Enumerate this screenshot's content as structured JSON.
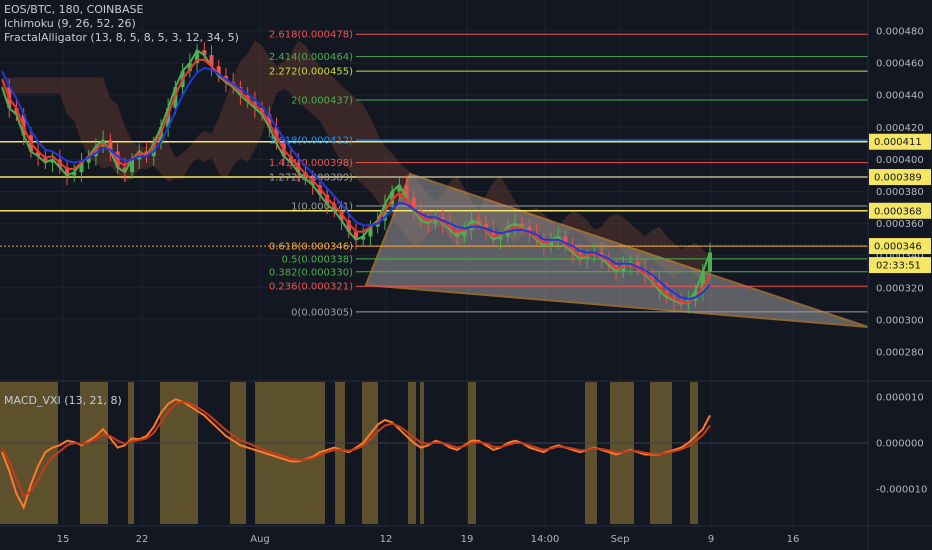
{
  "header": {
    "symbol_line": "EOS/BTC, 180, COINBASE",
    "ichimoku": "Ichimoku (9, 26, 52, 26)",
    "alligator": "FractalAlligator (13, 8, 5, 8, 5, 3, 12, 34, 5)"
  },
  "macd_label": "MACD_VXI (13, 21, 8)",
  "colors": {
    "background": "#131722",
    "grid": "#1e2230",
    "yellow": "#f5e663",
    "triangle_fill": "#9a9a9a",
    "triangle_stroke": "#f4a83a",
    "candle_up": "#4caf50",
    "candle_down": "#ef5350",
    "lip": "#4caf50",
    "teeth": "#e53935",
    "jaw": "#1e3adb",
    "macd": "#ff7a2a",
    "signal": "#c43b1a",
    "macd_bg": "#6b5a2e"
  },
  "chart_data": {
    "type": "line",
    "title": "EOS/BTC, 180, COINBASE",
    "ylim": [
      0.00027,
      0.00049
    ],
    "y_ticks": [
      "0.000480",
      "0.000460",
      "0.000440",
      "0.000420",
      "0.000400",
      "0.000380",
      "0.000360",
      "0.000340",
      "0.000320",
      "0.000300",
      "0.000280"
    ],
    "x_ticks": [
      "15",
      "22",
      "Aug",
      "12",
      "19",
      "14:00",
      "Sep",
      "9",
      "16"
    ],
    "price_tags": [
      {
        "label": "0.000411",
        "value": 0.000411,
        "color": "#f5e663"
      },
      {
        "label": "0.000389",
        "value": 0.000389,
        "color": "#f5e663"
      },
      {
        "label": "0.000368",
        "value": 0.000368,
        "color": "#f5e663"
      },
      {
        "label": "0.000346",
        "value": 0.000346,
        "color": "#f5e663"
      }
    ],
    "countdown": "02:33:51",
    "horizontal_levels": [
      0.000411,
      0.000389,
      0.000368
    ],
    "fib_levels": [
      {
        "label": "2.618(0.000478)",
        "value": 0.000478,
        "color": "#ef5350"
      },
      {
        "label": "2.414(0.000464)",
        "value": 0.000464,
        "color": "#4caf50"
      },
      {
        "label": "2.272(0.000455)",
        "value": 0.000455,
        "color": "#cddc39"
      },
      {
        "label": "2(0.000437)",
        "value": 0.000437,
        "color": "#4caf50"
      },
      {
        "label": "1.618(0.000412)",
        "value": 0.000412,
        "color": "#2196f3"
      },
      {
        "label": "1.414(0.000398)",
        "value": 0.000398,
        "color": "#ef5350"
      },
      {
        "label": "1.272(0.000389)",
        "value": 0.000389,
        "color": "#9e9e9e"
      },
      {
        "label": "1(0.000371)",
        "value": 0.000371,
        "color": "#9e9e9e"
      },
      {
        "label": "0.618(0.000346)",
        "value": 0.000346,
        "color": "#f4a83a"
      },
      {
        "label": "0.5(0.000338)",
        "value": 0.000338,
        "color": "#4caf50"
      },
      {
        "label": "0.382(0.000330)",
        "value": 0.00033,
        "color": "#4caf50"
      },
      {
        "label": "0.236(0.000321)",
        "value": 0.000321,
        "color": "#ef5350"
      },
      {
        "label": "0(0.000305)",
        "value": 0.000305,
        "color": "#9e9e9e"
      }
    ],
    "series": [
      {
        "values": [
          0.000445,
          0.000432,
          0.000428,
          0.000415,
          0.000405,
          0.000402,
          0.000398,
          0.0004,
          0.000395,
          0.00039,
          0.000392,
          0.000398,
          0.000402,
          0.000408,
          0.000412,
          0.000405,
          0.000395,
          0.000392,
          0.0004,
          0.000405,
          0.000402,
          0.00041,
          0.00042,
          0.000432,
          0.000445,
          0.000455,
          0.00046,
          0.000468,
          0.000465,
          0.000458,
          0.000452,
          0.000448,
          0.000445,
          0.00044,
          0.000436,
          0.000432,
          0.000428,
          0.00042,
          0.00041,
          0.000402,
          0.000398,
          0.000392,
          0.000388,
          0.000384,
          0.000378,
          0.000372,
          0.000368,
          0.000362,
          0.000355,
          0.00035,
          0.000352,
          0.000358,
          0.000362,
          0.000372,
          0.00038,
          0.000384,
          0.000376,
          0.000368,
          0.000362,
          0.00036,
          0.000364,
          0.00036,
          0.000356,
          0.000352,
          0.000356,
          0.000362,
          0.00036,
          0.000356,
          0.00035,
          0.000352,
          0.000358,
          0.00036,
          0.000358,
          0.000354,
          0.00035,
          0.000346,
          0.00035,
          0.000352,
          0.000346,
          0.000342,
          0.000338,
          0.00034,
          0.000342,
          0.000338,
          0.000334,
          0.00033,
          0.000334,
          0.000336,
          0.000332,
          0.000328,
          0.000324,
          0.000318,
          0.000314,
          0.000312,
          0.00031,
          0.000312,
          0.000318,
          0.00033,
          0.000342
        ]
      },
      {
        "values": [
          0.00045,
          0.000438,
          0.000432,
          0.00042,
          0.00041,
          0.000405,
          0.000401,
          0.000402,
          0.000398,
          0.000394,
          0.000394,
          0.000398,
          0.000402,
          0.000406,
          0.00041,
          0.000406,
          0.000399,
          0.000396,
          0.0004,
          0.000404,
          0.000402,
          0.000408,
          0.000416,
          0.000428,
          0.00044,
          0.00045,
          0.000456,
          0.000462,
          0.000462,
          0.000458,
          0.000453,
          0.000449,
          0.000446,
          0.000442,
          0.000438,
          0.000434,
          0.00043,
          0.000423,
          0.000414,
          0.000406,
          0.000401,
          0.000396,
          0.000391,
          0.000387,
          0.000382,
          0.000376,
          0.000371,
          0.000366,
          0.00036,
          0.000355,
          0.000355,
          0.000358,
          0.000361,
          0.000368,
          0.000375,
          0.000379,
          0.000375,
          0.000369,
          0.000364,
          0.000362,
          0.000363,
          0.000361,
          0.000358,
          0.000355,
          0.000356,
          0.000359,
          0.000359,
          0.000356,
          0.000352,
          0.000353,
          0.000356,
          0.000358,
          0.000357,
          0.000354,
          0.000351,
          0.000348,
          0.000349,
          0.00035,
          0.000347,
          0.000344,
          0.00034,
          0.00034,
          0.000341,
          0.000339,
          0.000336,
          0.000332,
          0.000333,
          0.000334,
          0.000332,
          0.000329,
          0.000325,
          0.00032,
          0.000316,
          0.000313,
          0.000311,
          0.000311,
          0.000314,
          0.00032,
          0.000328
        ]
      },
      {
        "values": [
          0.000455,
          0.000446,
          0.000438,
          0.000428,
          0.000418,
          0.000411,
          0.000406,
          0.000405,
          0.000402,
          0.000399,
          0.000398,
          0.000399,
          0.000401,
          0.000404,
          0.000407,
          0.000406,
          0.000402,
          0.000399,
          0.0004,
          0.000402,
          0.000402,
          0.000405,
          0.000411,
          0.00042,
          0.00043,
          0.00044,
          0.000448,
          0.000454,
          0.000457,
          0.000456,
          0.000453,
          0.00045,
          0.000447,
          0.000444,
          0.000441,
          0.000437,
          0.000433,
          0.000427,
          0.00042,
          0.000413,
          0.000407,
          0.000401,
          0.000396,
          0.000391,
          0.000387,
          0.000382,
          0.000377,
          0.000372,
          0.000366,
          0.000361,
          0.000359,
          0.000359,
          0.00036,
          0.000364,
          0.000369,
          0.000373,
          0.000372,
          0.000369,
          0.000366,
          0.000364,
          0.000364,
          0.000362,
          0.00036,
          0.000358,
          0.000357,
          0.000358,
          0.000358,
          0.000357,
          0.000355,
          0.000354,
          0.000355,
          0.000356,
          0.000356,
          0.000355,
          0.000353,
          0.00035,
          0.00035,
          0.00035,
          0.000348,
          0.000346,
          0.000343,
          0.000342,
          0.000342,
          0.00034,
          0.000338,
          0.000335,
          0.000335,
          0.000335,
          0.000333,
          0.000331,
          0.000328,
          0.000324,
          0.00032,
          0.000317,
          0.000314,
          0.000313,
          0.000314,
          0.000317,
          0.000322
        ]
      }
    ],
    "macd_series": [
      {
        "values": [
          -2e-06,
          -6e-06,
          -1.1e-05,
          -1.4e-05,
          -9e-06,
          -5e-06,
          -2e-06,
          -1e-06,
          -5e-07,
          5e-07,
          2e-07,
          -5e-07,
          5e-07,
          1.5e-06,
          3e-06,
          1e-06,
          -1e-06,
          -5e-07,
          1e-06,
          8e-07,
          1.5e-06,
          3.5e-06,
          6.5e-06,
          8.5e-06,
          9.5e-06,
          9e-06,
          8e-06,
          7e-06,
          6e-06,
          4.5e-06,
          3e-06,
          1.5e-06,
          5e-07,
          -5e-07,
          -1e-06,
          -1.5e-06,
          -2e-06,
          -2.5e-06,
          -3e-06,
          -3.5e-06,
          -4e-06,
          -4e-06,
          -3.5e-06,
          -3e-06,
          -2e-06,
          -1.5e-06,
          -1e-06,
          -1.5e-06,
          -2e-06,
          -1e-06,
          0.0,
          2e-06,
          4e-06,
          5e-06,
          4.5e-06,
          3e-06,
          1.5e-06,
          0.0,
          -1e-06,
          -5e-07,
          5e-07,
          0.0,
          -1e-06,
          -1.5e-06,
          -5e-07,
          5e-07,
          5e-07,
          -5e-07,
          -1.5e-06,
          -1e-06,
          0.0,
          5e-07,
          0.0,
          -1e-06,
          -1.5e-06,
          -2e-06,
          -1e-06,
          -5e-07,
          -1e-06,
          -1.5e-06,
          -2e-06,
          -1.5e-06,
          -1e-06,
          -1.5e-06,
          -2e-06,
          -2.5e-06,
          -2e-06,
          -1.5e-06,
          -2e-06,
          -2.5e-06,
          -2.5e-06,
          -2.5e-06,
          -2e-06,
          -1.5e-06,
          -1e-06,
          0.0,
          1.5e-06,
          3e-06,
          6e-06
        ]
      },
      {
        "values": [
          -1e-06,
          -4e-06,
          -8e-06,
          -1.15e-05,
          -1.05e-05,
          -8e-06,
          -5e-06,
          -3e-06,
          -1.8e-06,
          -5e-07,
          0.0,
          -2e-07,
          1e-07,
          8e-07,
          1.8e-06,
          1.5e-06,
          5e-07,
          -2e-07,
          4e-07,
          6e-07,
          1e-06,
          2.2e-06,
          4.5e-06,
          6.8e-06,
          8.5e-06,
          9e-06,
          8.6e-06,
          7.8e-06,
          6.8e-06,
          5.6e-06,
          4.2e-06,
          2.8e-06,
          1.6e-06,
          6e-07,
          0.0,
          -7e-07,
          -1.3e-06,
          -1.9e-06,
          -2.4e-06,
          -2.9e-06,
          -3.4e-06,
          -3.7e-06,
          -3.6e-06,
          -3.3e-06,
          -2.6e-06,
          -2e-06,
          -1.5e-06,
          -1.5e-06,
          -1.7e-06,
          -1.3e-06,
          -6e-07,
          8e-07,
          2.5e-06,
          3.8e-06,
          4.2e-06,
          3.6e-06,
          2.5e-06,
          1.2e-06,
          1e-07,
          -2e-07,
          1e-07,
          0.0,
          -5e-07,
          -1e-06,
          -7e-07,
          0.0,
          2e-07,
          -1e-07,
          -8e-07,
          -9e-07,
          -4e-07,
          0.0,
          0.0,
          -5e-07,
          -1e-06,
          -1.5e-06,
          -1.2e-06,
          -8e-07,
          -9e-07,
          -1.2e-06,
          -1.6e-06,
          -1.5e-06,
          -1.2e-06,
          -1.3e-06,
          -1.6e-06,
          -2e-06,
          -2e-06,
          -1.7e-06,
          -1.8e-06,
          -2.1e-06,
          -2.3e-06,
          -2.4e-06,
          -2.2e-06,
          -1.8e-06,
          -1.4e-06,
          -7e-07,
          4e-07,
          1.7e-06,
          3.8e-06
        ]
      }
    ],
    "macd_y_ticks": [
      "0.000010",
      "0.000000",
      "-0.000010"
    ],
    "macd_ylim": [
      -1.6e-05,
      1.3e-05
    ]
  }
}
